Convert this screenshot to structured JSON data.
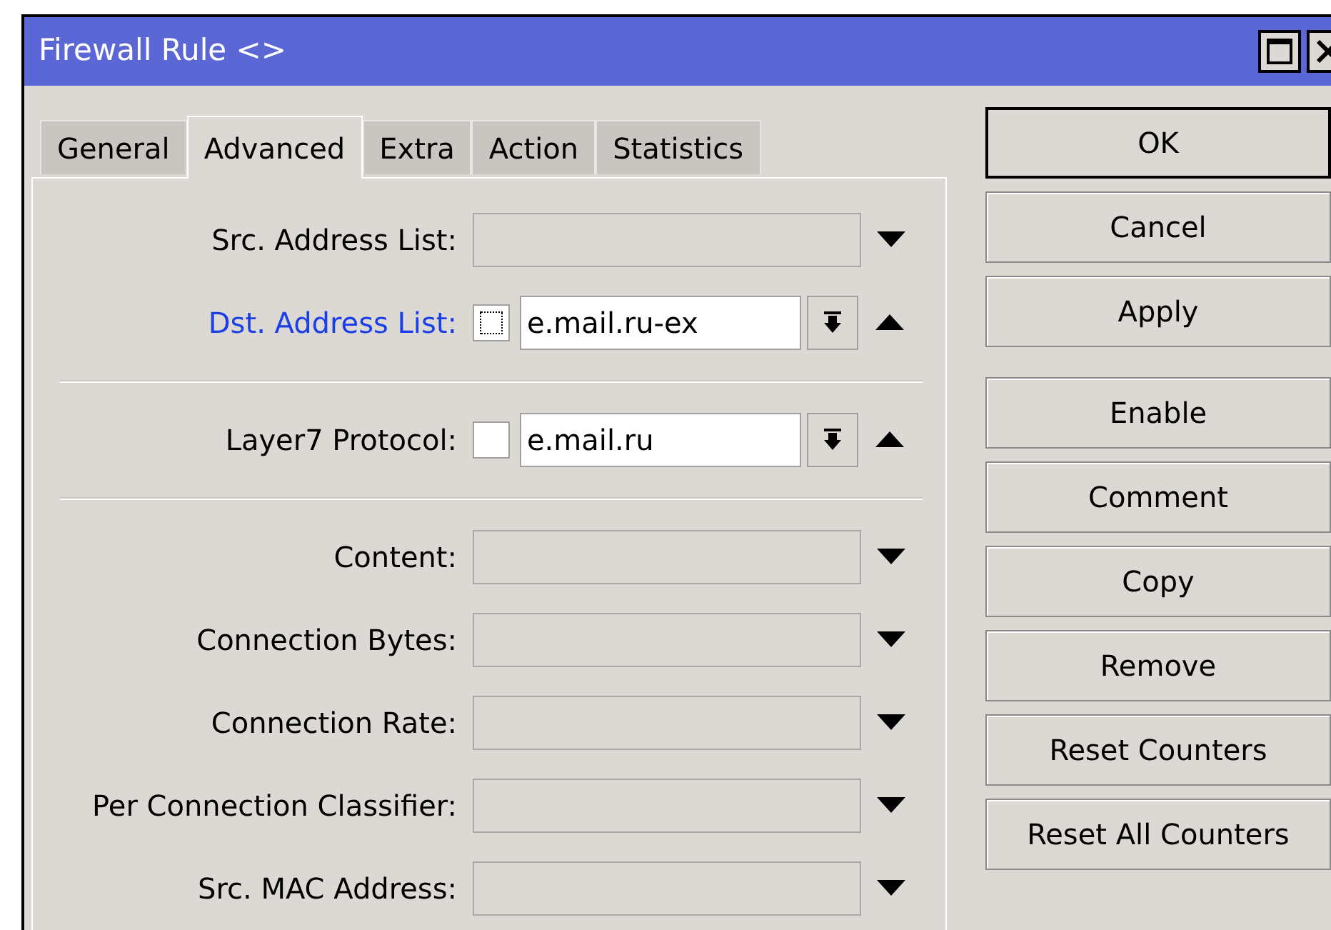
{
  "window": {
    "title": "Firewall Rule <>"
  },
  "tabs": [
    {
      "label": "General",
      "selected": false
    },
    {
      "label": "Advanced",
      "selected": true
    },
    {
      "label": "Extra",
      "selected": false
    },
    {
      "label": "Action",
      "selected": false
    },
    {
      "label": "Statistics",
      "selected": false
    }
  ],
  "groups": [
    [
      {
        "kind": "dropdown",
        "label": "Src. Address List:",
        "highlighted": false
      },
      {
        "kind": "negatable",
        "label": "Dst. Address List:",
        "highlighted": true,
        "focused": true,
        "checked": false,
        "value": "e.mail.ru-ex"
      }
    ],
    [
      {
        "kind": "negatable",
        "label": "Layer7 Protocol:",
        "highlighted": false,
        "focused": false,
        "checked": false,
        "value": "e.mail.ru"
      }
    ],
    [
      {
        "kind": "dropdown",
        "label": "Content:",
        "highlighted": false
      },
      {
        "kind": "dropdown",
        "label": "Connection Bytes:",
        "highlighted": false
      },
      {
        "kind": "dropdown",
        "label": "Connection Rate:",
        "highlighted": false
      },
      {
        "kind": "dropdown",
        "label": "Per Connection Classifier:",
        "highlighted": false
      },
      {
        "kind": "dropdown",
        "label": "Src. MAC Address:",
        "highlighted": false
      }
    ]
  ],
  "buttons": [
    {
      "label": "OK",
      "default": true
    },
    {
      "label": "Cancel",
      "default": false
    },
    {
      "label": "Apply",
      "default": false
    },
    {
      "label": "Enable",
      "default": false
    },
    {
      "label": "Comment",
      "default": false
    },
    {
      "label": "Copy",
      "default": false
    },
    {
      "label": "Remove",
      "default": false
    },
    {
      "label": "Reset Counters",
      "default": false
    },
    {
      "label": "Reset All Counters",
      "default": false
    }
  ]
}
